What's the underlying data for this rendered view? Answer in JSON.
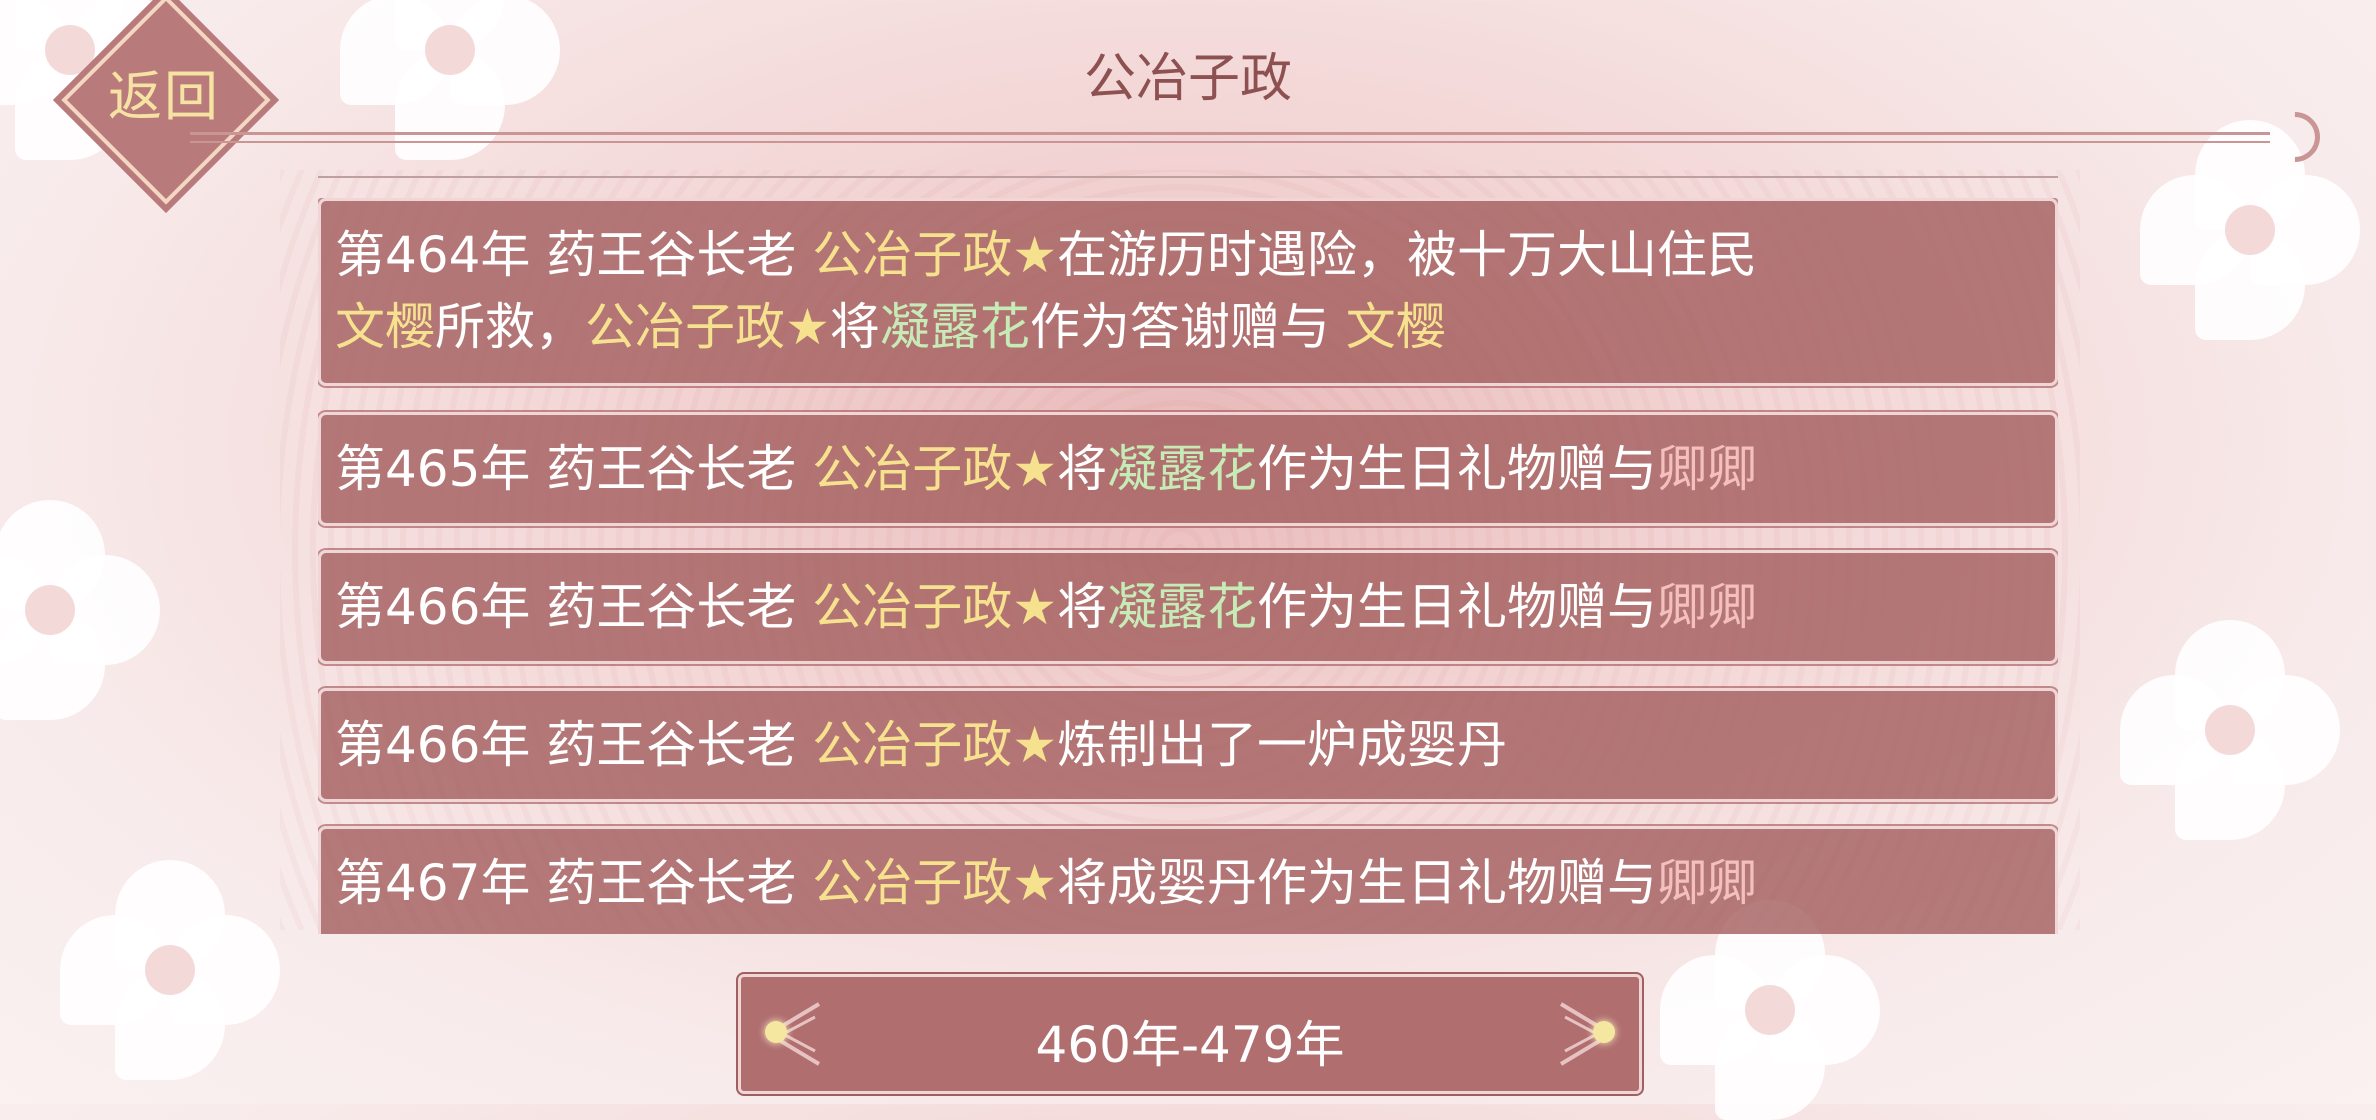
{
  "header": {
    "back_label": "返回",
    "title": "公冶子政"
  },
  "entries": [
    {
      "year": "第464年",
      "prefix": " 药王谷长老 ",
      "name": "公冶子政★",
      "line1_rest": "在游历时遇险，被十万大山住民",
      "rescuer": "文樱",
      "mid1": "所救，",
      "name2": "公冶子政★",
      "mid2": "将",
      "item": "凝露花",
      "mid3": "作为答谢赠与 ",
      "recipient": "文樱"
    },
    {
      "year": "第465年",
      "prefix": " 药王谷长老 ",
      "name": "公冶子政★",
      "mid1": "将",
      "item": "凝露花",
      "mid2": "作为生日礼物赠与",
      "recipient": "卿卿"
    },
    {
      "year": "第466年",
      "prefix": " 药王谷长老 ",
      "name": "公冶子政★",
      "mid1": "将",
      "item": "凝露花",
      "mid2": "作为生日礼物赠与",
      "recipient": "卿卿"
    },
    {
      "year": "第466年",
      "prefix": " 药王谷长老 ",
      "name": "公冶子政★",
      "rest": "炼制出了一炉成婴丹"
    },
    {
      "year": "第467年",
      "prefix": " 药王谷长老 ",
      "name": "公冶子政★",
      "mid1": "将成婴丹作为生日礼物赠与",
      "recipient": "卿卿"
    }
  ],
  "pager": {
    "label": "460年-479年"
  },
  "colors": {
    "name_yellow": "#f6e28e",
    "item_green": "#c7ebb6",
    "recipient_pink": "#f4c0bd",
    "entry_bg": "#a35c5c"
  }
}
